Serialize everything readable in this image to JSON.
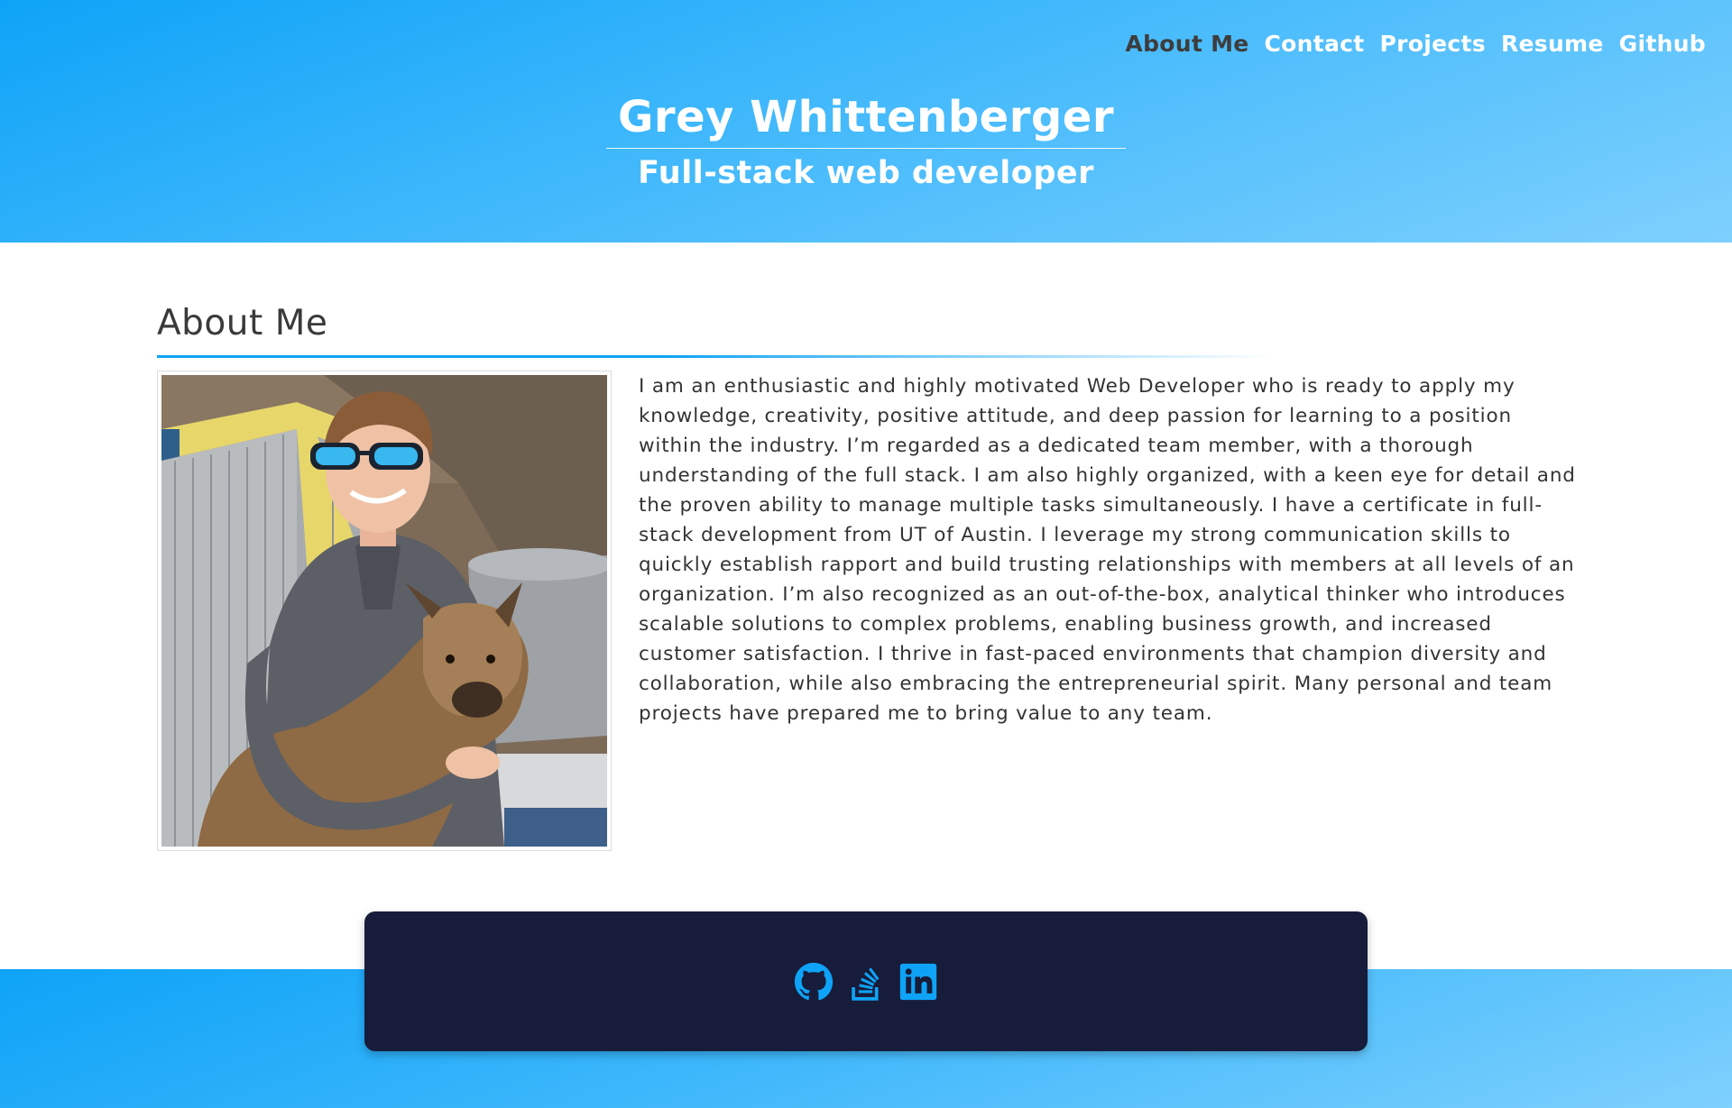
{
  "nav": {
    "items": [
      {
        "label": "About Me",
        "active": true
      },
      {
        "label": "Contact",
        "active": false
      },
      {
        "label": "Projects",
        "active": false
      },
      {
        "label": "Resume",
        "active": false
      },
      {
        "label": "Github",
        "active": false
      }
    ]
  },
  "header": {
    "name": "Grey Whittenberger",
    "subtitle": "Full-stack web developer"
  },
  "about": {
    "heading": "About Me",
    "body": "I am an enthusiastic and highly motivated Web Developer who is ready to apply my knowledge, creativity, positive attitude, and deep passion for learning to a position within the industry. I’m regarded as a dedicated team member, with a thorough understanding of the full stack. I am also highly organized, with a keen eye for detail and the proven ability to manage multiple tasks simultaneously. I have a certificate in full-stack development from UT of Austin. I leverage my strong communication skills to quickly establish rapport and build trusting relationships with members at all levels of an organization. I’m also recognized as an out-of-the-box, analytical thinker who introduces scalable solutions to complex problems, enabling business growth, and increased customer satisfaction. I thrive in fast-paced environments that champion diversity and collaboration, while also embracing the entrepreneurial spirit. Many personal and team projects have prepared me to bring value to any team."
  },
  "footer": {
    "icons": [
      "github-icon",
      "stackoverflow-icon",
      "linkedin-icon"
    ]
  },
  "colors": {
    "accent": "#0ea3f7",
    "footer_card": "#171c3a",
    "nav_active": "#3d3d3d"
  }
}
